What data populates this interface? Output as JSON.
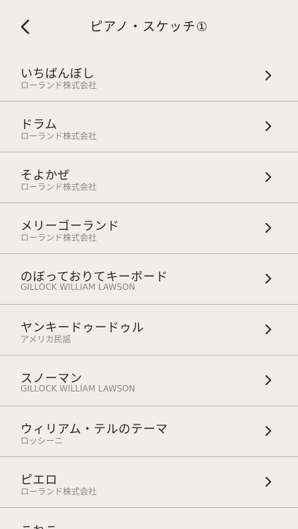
{
  "header": {
    "title": "ピアノ・スケッチ①",
    "back_icon": "chevron-left-icon"
  },
  "songs": [
    {
      "title": "いちばんぼし",
      "subtitle": "ローランド株式会社"
    },
    {
      "title": "ドラム",
      "subtitle": "ローランド株式会社"
    },
    {
      "title": "そよかぜ",
      "subtitle": "ローランド株式会社"
    },
    {
      "title": "メリーゴーランド",
      "subtitle": "ローランド株式会社"
    },
    {
      "title": "のぼっておりてキーボード",
      "subtitle": "GILLOCK WILLIAM LAWSON"
    },
    {
      "title": "ヤンキードゥードゥル",
      "subtitle": "アメリカ民謡"
    },
    {
      "title": "スノーマン",
      "subtitle": "GILLOCK WILLIAM LAWSON"
    },
    {
      "title": "ウィリアム・テルのテーマ",
      "subtitle": "ロッシーニ"
    },
    {
      "title": "ピエロ",
      "subtitle": "ローランド株式会社"
    },
    {
      "title": "こねこ",
      "subtitle": ""
    }
  ],
  "row_icon": "chevron-right-icon"
}
